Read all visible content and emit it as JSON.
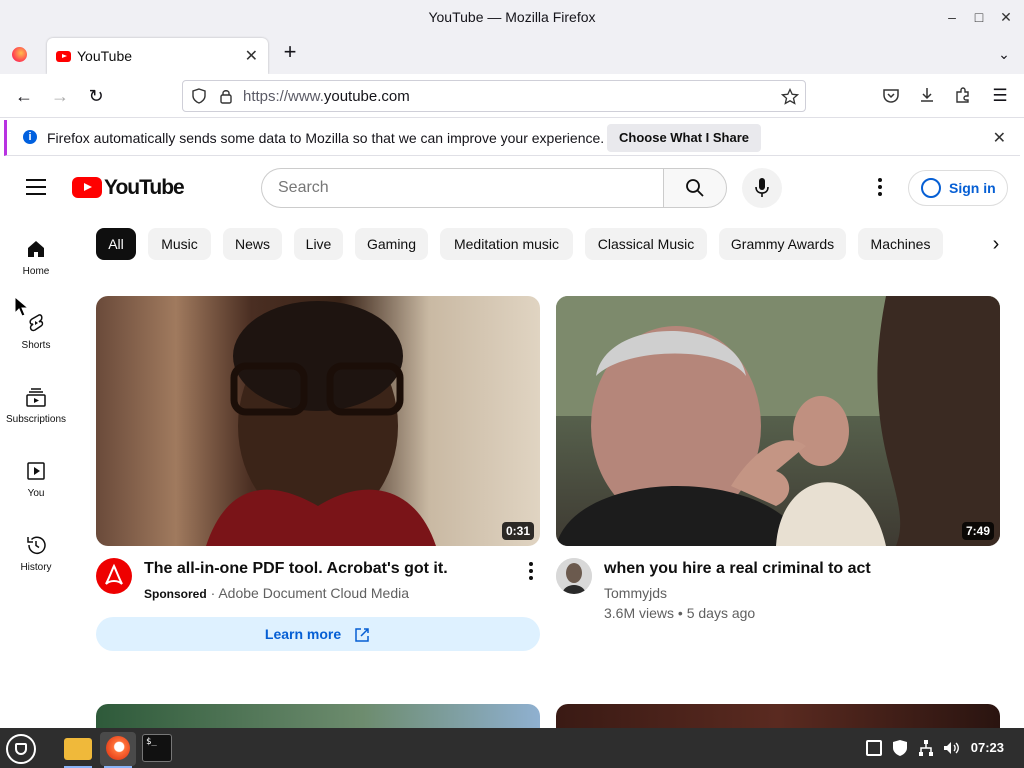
{
  "window": {
    "title": "YouTube — Mozilla Firefox"
  },
  "tab": {
    "label": "YouTube"
  },
  "nav": {
    "url_prefix": "https://www.",
    "url_domain": "youtube.com"
  },
  "notification": {
    "message": "Firefox automatically sends some data to Mozilla so that we can improve your experience.",
    "action_label": "Choose What I Share"
  },
  "header": {
    "logo_text": "YouTube",
    "search_placeholder": "Search",
    "signin_label": "Sign in"
  },
  "sidebar": {
    "items": [
      {
        "label": "Home"
      },
      {
        "label": "Shorts"
      },
      {
        "label": "Subscriptions"
      },
      {
        "label": "You"
      },
      {
        "label": "History"
      }
    ]
  },
  "chips": [
    "All",
    "Music",
    "News",
    "Live",
    "Gaming",
    "Meditation music",
    "Classical Music",
    "Grammy Awards",
    "Machines"
  ],
  "videos": [
    {
      "title": "The all-in-one PDF tool. Acrobat's got it.",
      "sponsored_label": "Sponsored",
      "channel": "Adobe Document Cloud Media",
      "duration": "0:31",
      "cta": "Learn more"
    },
    {
      "title": "when you hire a real criminal to act",
      "channel": "Tommyjds",
      "stats": "3.6M views • 5 days ago",
      "duration": "7:49"
    }
  ],
  "taskbar": {
    "clock": "07:23"
  },
  "colors": {
    "youtube_red": "#ff0000",
    "link_blue": "#065fd4",
    "chip_bg": "#f2f2f2"
  }
}
